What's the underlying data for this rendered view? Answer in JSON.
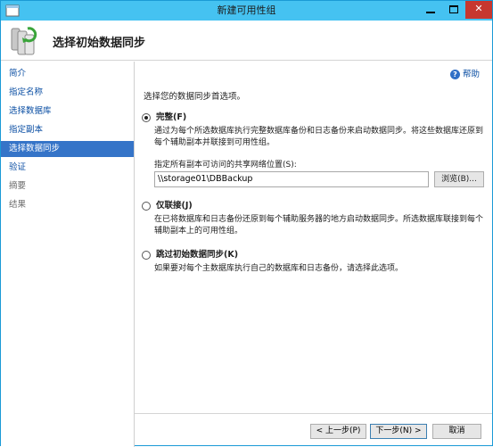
{
  "window": {
    "title": "新建可用性组"
  },
  "header": {
    "title": "选择初始数据同步"
  },
  "sidebar": {
    "items": [
      {
        "label": "简介",
        "state": "link"
      },
      {
        "label": "指定名称",
        "state": "link"
      },
      {
        "label": "选择数据库",
        "state": "link"
      },
      {
        "label": "指定副本",
        "state": "link"
      },
      {
        "label": "选择数据同步",
        "state": "active"
      },
      {
        "label": "验证",
        "state": "link"
      },
      {
        "label": "摘要",
        "state": "disabled"
      },
      {
        "label": "结果",
        "state": "disabled"
      }
    ]
  },
  "content": {
    "help_label": "帮助",
    "section_title": "选择您的数据同步首选项。",
    "options": [
      {
        "label": "完整(F)",
        "selected": true,
        "description": "通过为每个所选数据库执行完整数据库备份和日志备份来启动数据同步。将这些数据库还原到每个辅助副本并联接到可用性组。"
      },
      {
        "label": "仅联接(J)",
        "selected": false,
        "description": "在已将数据库和日志备份还原到每个辅助服务器的地方启动数据同步。所选数据库联接到每个辅助副本上的可用性组。"
      },
      {
        "label": "跳过初始数据同步(K)",
        "selected": false,
        "description": "如果要对每个主数据库执行自己的数据库和日志备份，请选择此选项。"
      }
    ],
    "path_label": "指定所有副本可访问的共享网络位置(S):",
    "path_value": "\\\\storage01\\DBBackup",
    "browse_label": "浏览(B)..."
  },
  "footer": {
    "prev_label": "< 上一步(P)",
    "next_label": "下一步(N) >",
    "cancel_label": "取消"
  },
  "colors": {
    "titlebar": "#45c2f1",
    "close": "#c7372f",
    "active_nav": "#3574c8",
    "link": "#0a4ea3"
  }
}
